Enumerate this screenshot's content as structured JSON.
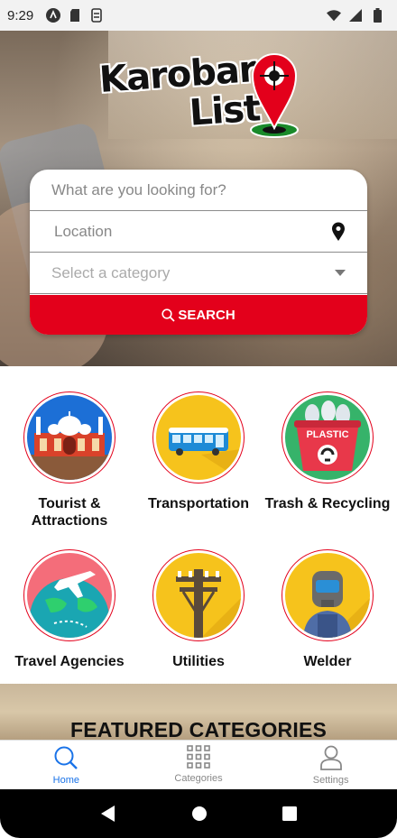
{
  "status_bar": {
    "time": "9:29",
    "left_icons": [
      "android-icon",
      "sd-card-icon",
      "sync-icon"
    ],
    "right_icons": [
      "wifi-icon",
      "signal-icon",
      "battery-icon"
    ]
  },
  "app": {
    "logo_line1": "Karobar",
    "logo_line2": "List",
    "brand_color": "#e3001b"
  },
  "search": {
    "query_placeholder": "What are you looking for?",
    "location_placeholder": "Location",
    "category_placeholder": "Select a category",
    "button_label": "SEARCH"
  },
  "categories": [
    {
      "label": "Tourist & Attractions",
      "icon": "mosque-icon"
    },
    {
      "label": "Transportation",
      "icon": "bus-icon"
    },
    {
      "label": "Trash & Recycling",
      "icon": "plastic-bin-icon",
      "badge": "PLASTIC"
    },
    {
      "label": "Travel Agencies",
      "icon": "airplane-globe-icon"
    },
    {
      "label": "Utilities",
      "icon": "power-pole-icon"
    },
    {
      "label": "Welder",
      "icon": "welder-icon"
    }
  ],
  "featured": {
    "title": "FEATURED CATEGORIES"
  },
  "bottom_nav": [
    {
      "label": "Home",
      "icon": "search-icon",
      "active": true
    },
    {
      "label": "Categories",
      "icon": "grid-icon",
      "active": false
    },
    {
      "label": "Settings",
      "icon": "person-icon",
      "active": false
    }
  ],
  "system_nav": [
    "back-icon",
    "home-icon",
    "recents-icon"
  ]
}
